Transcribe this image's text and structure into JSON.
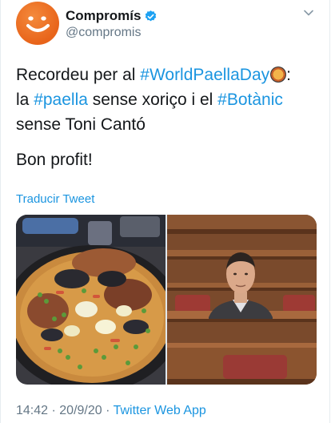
{
  "author": {
    "display_name": "Compromís",
    "handle": "@compromis",
    "avatar_icon": "smile-logo-icon",
    "verified_icon": "verified-badge-icon"
  },
  "tweet": {
    "line1_pre": "Recordeu per al ",
    "line1_tag": "#WorldPaellaDay",
    "line1_post": ":",
    "line2_pre": "la ",
    "line2_tag1": "#paella",
    "line2_mid": " sense xoriço i el ",
    "line2_tag2": "#Botànic",
    "line3": "sense Toni Cantó",
    "closing": "Bon profit!",
    "emoji_icon": "paella-emoji-icon"
  },
  "translate_label": "Traducir Tweet",
  "media": {
    "left_image": "paella-pan-photo",
    "right_image": "man-in-parliament-seats-photo"
  },
  "footer": {
    "time": "14:42",
    "separator1": " · ",
    "date": "20/9/20",
    "separator2": " · ",
    "app": "Twitter Web App"
  },
  "colors": {
    "link": "#1b95e0",
    "secondary_text": "#657786",
    "primary_text": "#14171a",
    "avatar_orange": "#e8641a"
  }
}
